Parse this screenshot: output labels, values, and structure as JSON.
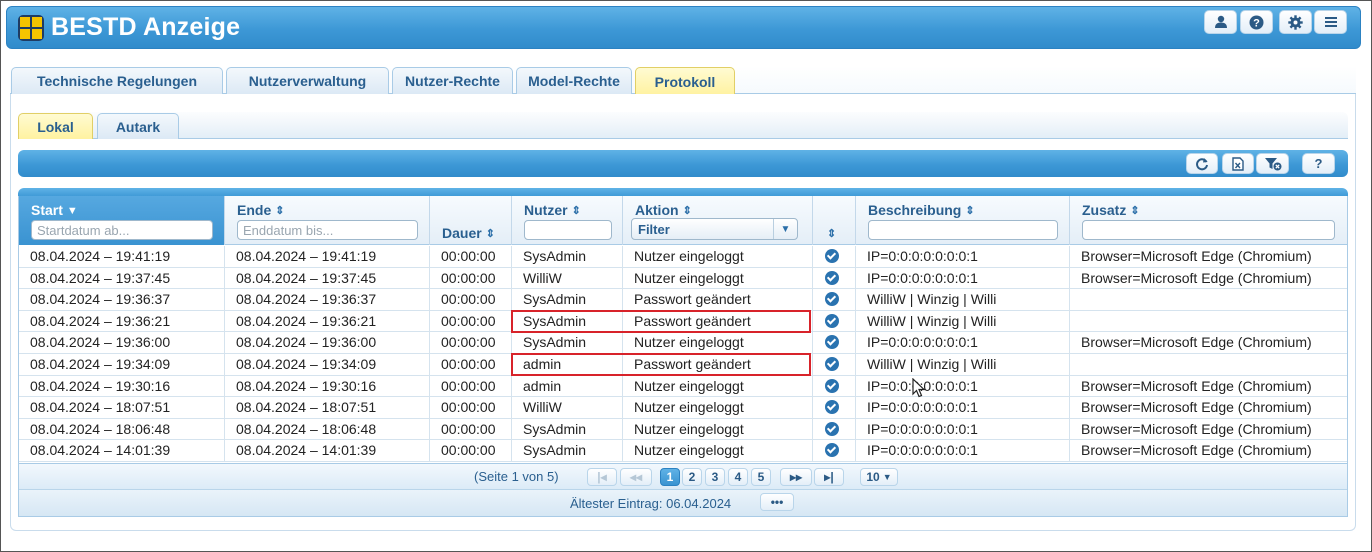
{
  "app": {
    "title": "BESTD Anzeige"
  },
  "header_buttons": [
    {
      "name": "user-button",
      "icon": "user-icon"
    },
    {
      "name": "help-button",
      "icon": "help-icon"
    },
    {
      "name": "settings-button",
      "icon": "gear-icon"
    },
    {
      "name": "menu-button",
      "icon": "menu-icon"
    }
  ],
  "tabs": [
    {
      "label": "Technische Regelungen",
      "active": false
    },
    {
      "label": "Nutzerverwaltung",
      "active": false
    },
    {
      "label": "Nutzer-Rechte",
      "active": false
    },
    {
      "label": "Model-Rechte",
      "active": false
    },
    {
      "label": "Protokoll",
      "active": true
    }
  ],
  "subtabs": [
    {
      "label": "Lokal",
      "active": true
    },
    {
      "label": "Autark",
      "active": false
    }
  ],
  "toolbar": {
    "buttons": [
      "refresh-icon",
      "excel-export-icon",
      "clear-filter-icon",
      "help-icon"
    ],
    "help_label": "?"
  },
  "grid": {
    "columns": {
      "start": "Start",
      "ende": "Ende",
      "dauer": "Dauer",
      "nutzer": "Nutzer",
      "aktion": "Aktion",
      "status": "",
      "beschreibung": "Beschreibung",
      "zusatz": "Zusatz"
    },
    "filters": {
      "start_placeholder": "Startdatum ab...",
      "ende_placeholder": "Enddatum bis...",
      "nutzer_value": "",
      "aktion_select": "Filter",
      "beschreibung_value": "",
      "zusatz_value": ""
    },
    "rows": [
      {
        "start": "08.04.2024 – 19:41:19",
        "ende": "08.04.2024 – 19:41:19",
        "dauer": "00:00:00",
        "nutzer": "SysAdmin",
        "aktion": "Nutzer eingeloggt",
        "beschreibung": "IP=0:0:0:0:0:0:0:1",
        "zusatz": "Browser=Microsoft Edge (Chromium)"
      },
      {
        "start": "08.04.2024 – 19:37:45",
        "ende": "08.04.2024 – 19:37:45",
        "dauer": "00:00:00",
        "nutzer": "WilliW",
        "aktion": "Nutzer eingeloggt",
        "beschreibung": "IP=0:0:0:0:0:0:0:1",
        "zusatz": "Browser=Microsoft Edge (Chromium)"
      },
      {
        "start": "08.04.2024 – 19:36:37",
        "ende": "08.04.2024 – 19:36:37",
        "dauer": "00:00:00",
        "nutzer": "SysAdmin",
        "aktion": "Passwort geändert",
        "beschreibung": "WilliW | Winzig | Willi",
        "zusatz": ""
      },
      {
        "start": "08.04.2024 – 19:36:21",
        "ende": "08.04.2024 – 19:36:21",
        "dauer": "00:00:00",
        "nutzer": "SysAdmin",
        "aktion": "Passwort geändert",
        "beschreibung": "WilliW | Winzig | Willi",
        "zusatz": ""
      },
      {
        "start": "08.04.2024 – 19:36:00",
        "ende": "08.04.2024 – 19:36:00",
        "dauer": "00:00:00",
        "nutzer": "SysAdmin",
        "aktion": "Nutzer eingeloggt",
        "beschreibung": "IP=0:0:0:0:0:0:0:1",
        "zusatz": "Browser=Microsoft Edge (Chromium)"
      },
      {
        "start": "08.04.2024 – 19:34:09",
        "ende": "08.04.2024 – 19:34:09",
        "dauer": "00:00:00",
        "nutzer": "admin",
        "aktion": "Passwort geändert",
        "beschreibung": "WilliW | Winzig | Willi",
        "zusatz": ""
      },
      {
        "start": "08.04.2024 – 19:30:16",
        "ende": "08.04.2024 – 19:30:16",
        "dauer": "00:00:00",
        "nutzer": "admin",
        "aktion": "Nutzer eingeloggt",
        "beschreibung": "IP=0:0:0:0:0:0:0:1",
        "zusatz": "Browser=Microsoft Edge (Chromium)"
      },
      {
        "start": "08.04.2024 – 18:07:51",
        "ende": "08.04.2024 – 18:07:51",
        "dauer": "00:00:00",
        "nutzer": "WilliW",
        "aktion": "Nutzer eingeloggt",
        "beschreibung": "IP=0:0:0:0:0:0:0:1",
        "zusatz": "Browser=Microsoft Edge (Chromium)"
      },
      {
        "start": "08.04.2024 – 18:06:48",
        "ende": "08.04.2024 – 18:06:48",
        "dauer": "00:00:00",
        "nutzer": "SysAdmin",
        "aktion": "Nutzer eingeloggt",
        "beschreibung": "IP=0:0:0:0:0:0:0:1",
        "zusatz": "Browser=Microsoft Edge (Chromium)"
      },
      {
        "start": "08.04.2024 – 14:01:39",
        "ende": "08.04.2024 – 14:01:39",
        "dauer": "00:00:00",
        "nutzer": "SysAdmin",
        "aktion": "Nutzer eingeloggt",
        "beschreibung": "IP=0:0:0:0:0:0:0:1",
        "zusatz": "Browser=Microsoft Edge (Chromium)"
      }
    ]
  },
  "pager": {
    "info": "(Seite 1 von 5)",
    "pages": [
      "1",
      "2",
      "3",
      "4",
      "5"
    ],
    "current_page": "1",
    "page_size": "10"
  },
  "footer": {
    "info": "Ältester Eintrag: 06.04.2024",
    "more_label": "•••"
  },
  "colors": {
    "accent": "#3d98d6",
    "active_tab": "#fff2a0",
    "highlight": "#d8232a"
  }
}
